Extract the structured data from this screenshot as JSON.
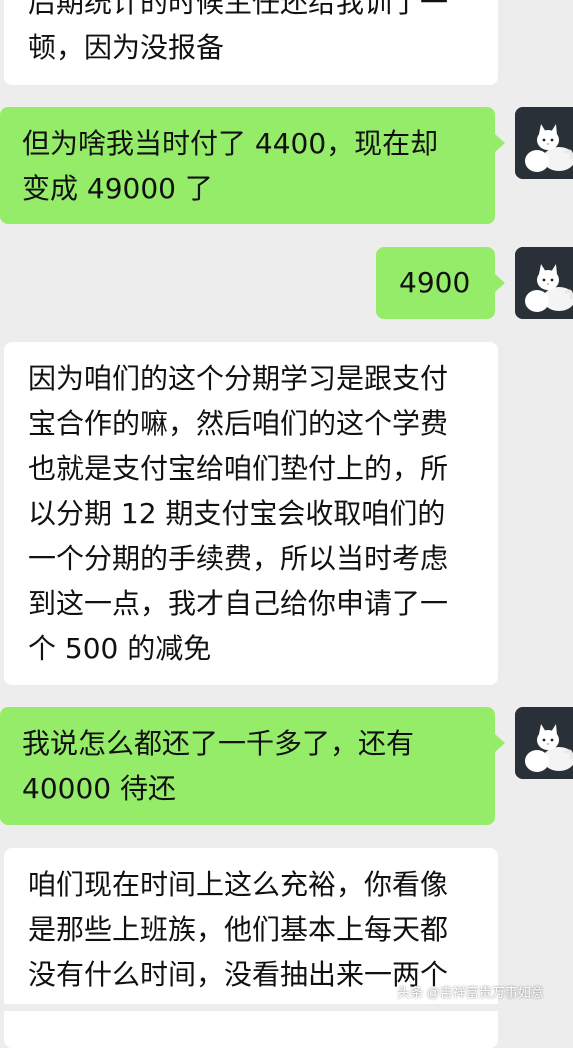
{
  "messages": [
    {
      "side": "in",
      "lines": [
        "后期统计的时候主任还给我训了一",
        "顿，因为没报备"
      ]
    },
    {
      "side": "out",
      "lines": [
        "但为啥我当时付了 4400，现在却",
        "变成 49000 了"
      ]
    },
    {
      "side": "out",
      "lines": [
        "4900"
      ]
    },
    {
      "side": "in",
      "lines": [
        "因为咱们的这个分期学习是跟支付",
        "宝合作的嘛，然后咱们的这个学费",
        "也就是支付宝给咱们垫付上的，所",
        "以分期 12 期支付宝会收取咱们的",
        "一个分期的手续费，所以当时考虑",
        "到这一点，我才自己给你申请了一",
        "个 500 的减免"
      ]
    },
    {
      "side": "out",
      "lines": [
        "我说怎么都还了一千多了，还有",
        "40000 待还"
      ]
    },
    {
      "side": "in",
      "lines": [
        "咱们现在时间上这么充裕，你看像",
        "是那些上班族，他们基本上每天都",
        "没有什么时间，没看抽出来一两个"
      ]
    }
  ],
  "watermark": "头条 @吉祥富贵万事如意",
  "avatar_icon": "cat-avatar-icon",
  "colors": {
    "background": "#ededed",
    "incoming_bubble": "#ffffff",
    "outgoing_bubble": "#95ec69",
    "text": "#111111",
    "avatar_bg": "#2a3038"
  }
}
